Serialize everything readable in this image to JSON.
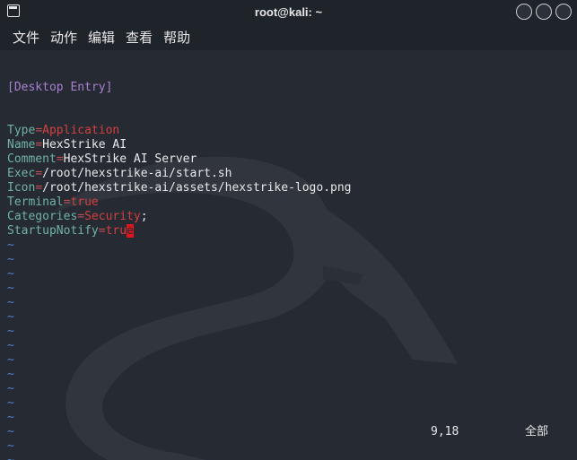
{
  "window": {
    "title": "root@kali: ~"
  },
  "menu": {
    "items": [
      "文件",
      "动作",
      "编辑",
      "查看",
      "帮助"
    ]
  },
  "editor": {
    "section": "[Desktop Entry]",
    "entries": [
      {
        "key": "Type",
        "value": "Application",
        "style": "red"
      },
      {
        "key": "Name",
        "value": "HexStrike AI",
        "style": "plain"
      },
      {
        "key": "Comment",
        "value": "HexStrike AI Server",
        "style": "plain"
      },
      {
        "key": "Exec",
        "value": "/root/hexstrike-ai/start.sh",
        "style": "plain"
      },
      {
        "key": "Icon",
        "value": "/root/hexstrike-ai/assets/hexstrike-logo.png",
        "style": "plain"
      },
      {
        "key": "Terminal",
        "value": "true",
        "style": "red"
      },
      {
        "key": "Categories",
        "value": "Security",
        "suffix": ";",
        "style": "red"
      },
      {
        "key": "StartupNotify",
        "value_before_cursor": "tru",
        "cursor_char": "e",
        "style": "red"
      }
    ],
    "tilde": "~",
    "empty_line_count": 17
  },
  "status": {
    "cursor_position": "9,18",
    "scroll_position": "全部"
  },
  "colors": {
    "background": "#262b33",
    "section": "#a97fd0",
    "key": "#6fb1a4",
    "value_red": "#d23f3f",
    "tilde": "#4c80c9",
    "cursor": "#e0151b"
  }
}
